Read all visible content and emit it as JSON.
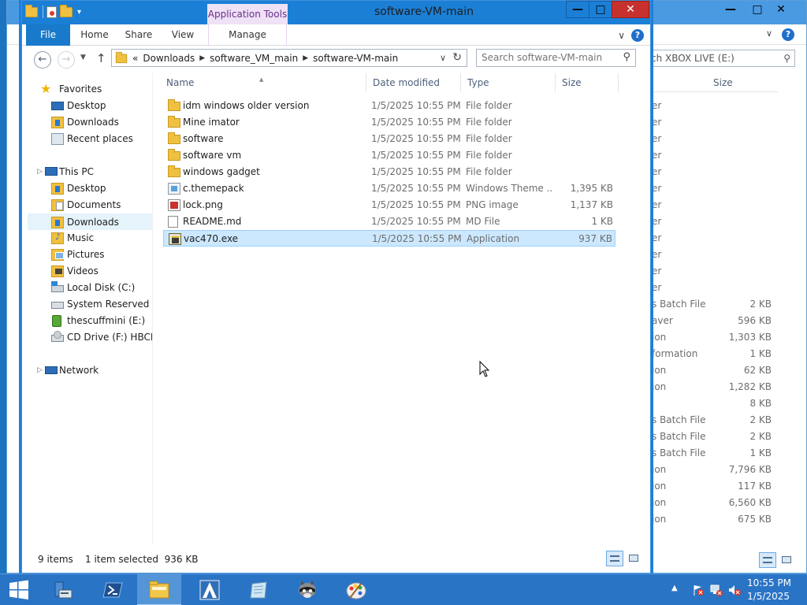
{
  "window": {
    "title": "software-VM-main",
    "contextual_tab_group": "Application Tools",
    "controls": {
      "minimize": "—",
      "maximize": "□",
      "close": "✕"
    }
  },
  "ribbon": {
    "tabs": [
      {
        "label": "File"
      },
      {
        "label": "Home"
      },
      {
        "label": "Share"
      },
      {
        "label": "View"
      },
      {
        "label": "Manage"
      }
    ]
  },
  "address": {
    "overflow": "«",
    "crumbs": [
      "Downloads",
      "software_VM_main",
      "software-VM-main"
    ]
  },
  "search": {
    "placeholder": "Search software-VM-main"
  },
  "nav": {
    "favorites_label": "Favorites",
    "favorites": [
      "Desktop",
      "Downloads",
      "Recent places"
    ],
    "this_pc_label": "This PC",
    "this_pc": [
      "Desktop",
      "Documents",
      "Downloads",
      "Music",
      "Pictures",
      "Videos",
      "Local Disk (C:)",
      "System Reserved (D:",
      "thescuffmini (E:)",
      "CD Drive (F:) HBCD_"
    ],
    "network_label": "Network"
  },
  "columns": {
    "name": "Name",
    "date": "Date modified",
    "type": "Type",
    "size": "Size"
  },
  "files": [
    {
      "name": "idm windows older version",
      "date": "1/5/2025 10:55 PM",
      "type": "File folder",
      "size": "",
      "icon": "folder-icon"
    },
    {
      "name": "Mine imator",
      "date": "1/5/2025 10:55 PM",
      "type": "File folder",
      "size": "",
      "icon": "folder-icon"
    },
    {
      "name": "software",
      "date": "1/5/2025 10:55 PM",
      "type": "File folder",
      "size": "",
      "icon": "folder-icon"
    },
    {
      "name": "software vm",
      "date": "1/5/2025 10:55 PM",
      "type": "File folder",
      "size": "",
      "icon": "folder-icon"
    },
    {
      "name": "windows gadget",
      "date": "1/5/2025 10:55 PM",
      "type": "File folder",
      "size": "",
      "icon": "folder-icon"
    },
    {
      "name": "c.themepack",
      "date": "1/5/2025 10:55 PM",
      "type": "Windows Theme ...",
      "size": "1,395 KB",
      "icon": "themepack-icon"
    },
    {
      "name": "lock.png",
      "date": "1/5/2025 10:55 PM",
      "type": "PNG image",
      "size": "1,137 KB",
      "icon": "png-file-icon"
    },
    {
      "name": "README.md",
      "date": "1/5/2025 10:55 PM",
      "type": "MD File",
      "size": "1 KB",
      "icon": "text-file-icon"
    },
    {
      "name": "vac470.exe",
      "date": "1/5/2025 10:55 PM",
      "type": "Application",
      "size": "937 KB",
      "icon": "exe-file-icon",
      "selected": true
    }
  ],
  "status": {
    "count": "9 items",
    "selection": "1 item selected  936 KB"
  },
  "background_window": {
    "search_placeholder": "ch XBOX LIVE (E:)",
    "size_header": "Size",
    "rows": [
      {
        "type": "er",
        "size": ""
      },
      {
        "type": "er",
        "size": ""
      },
      {
        "type": "er",
        "size": ""
      },
      {
        "type": "er",
        "size": ""
      },
      {
        "type": "er",
        "size": ""
      },
      {
        "type": "er",
        "size": ""
      },
      {
        "type": "er",
        "size": ""
      },
      {
        "type": "er",
        "size": ""
      },
      {
        "type": "er",
        "size": ""
      },
      {
        "type": "er",
        "size": ""
      },
      {
        "type": "er",
        "size": ""
      },
      {
        "type": "er",
        "size": ""
      },
      {
        "type": "s Batch File",
        "size": "2 KB"
      },
      {
        "type": "aver",
        "size": "596 KB"
      },
      {
        "type": "ion",
        "size": "1,303 KB"
      },
      {
        "type": "formation",
        "size": "1 KB"
      },
      {
        "type": "ion",
        "size": "62 KB"
      },
      {
        "type": "ion",
        "size": "1,282 KB"
      },
      {
        "type": "",
        "size": "8 KB"
      },
      {
        "type": "s Batch File",
        "size": "2 KB"
      },
      {
        "type": "s Batch File",
        "size": "2 KB"
      },
      {
        "type": "s Batch File",
        "size": "1 KB"
      },
      {
        "type": "ion",
        "size": "7,796 KB"
      },
      {
        "type": "ion",
        "size": "117 KB"
      },
      {
        "type": "ion",
        "size": "6,560 KB"
      },
      {
        "type": "ion",
        "size": "675 KB"
      }
    ]
  },
  "taskbar": {
    "items": [
      "server-manager-icon",
      "powershell-icon",
      "file-explorer-icon",
      "aoe-icon",
      "notepad-icon",
      "raccoon-icon",
      "paint-icon"
    ],
    "time": "10:55 PM",
    "date": "1/5/2025"
  }
}
